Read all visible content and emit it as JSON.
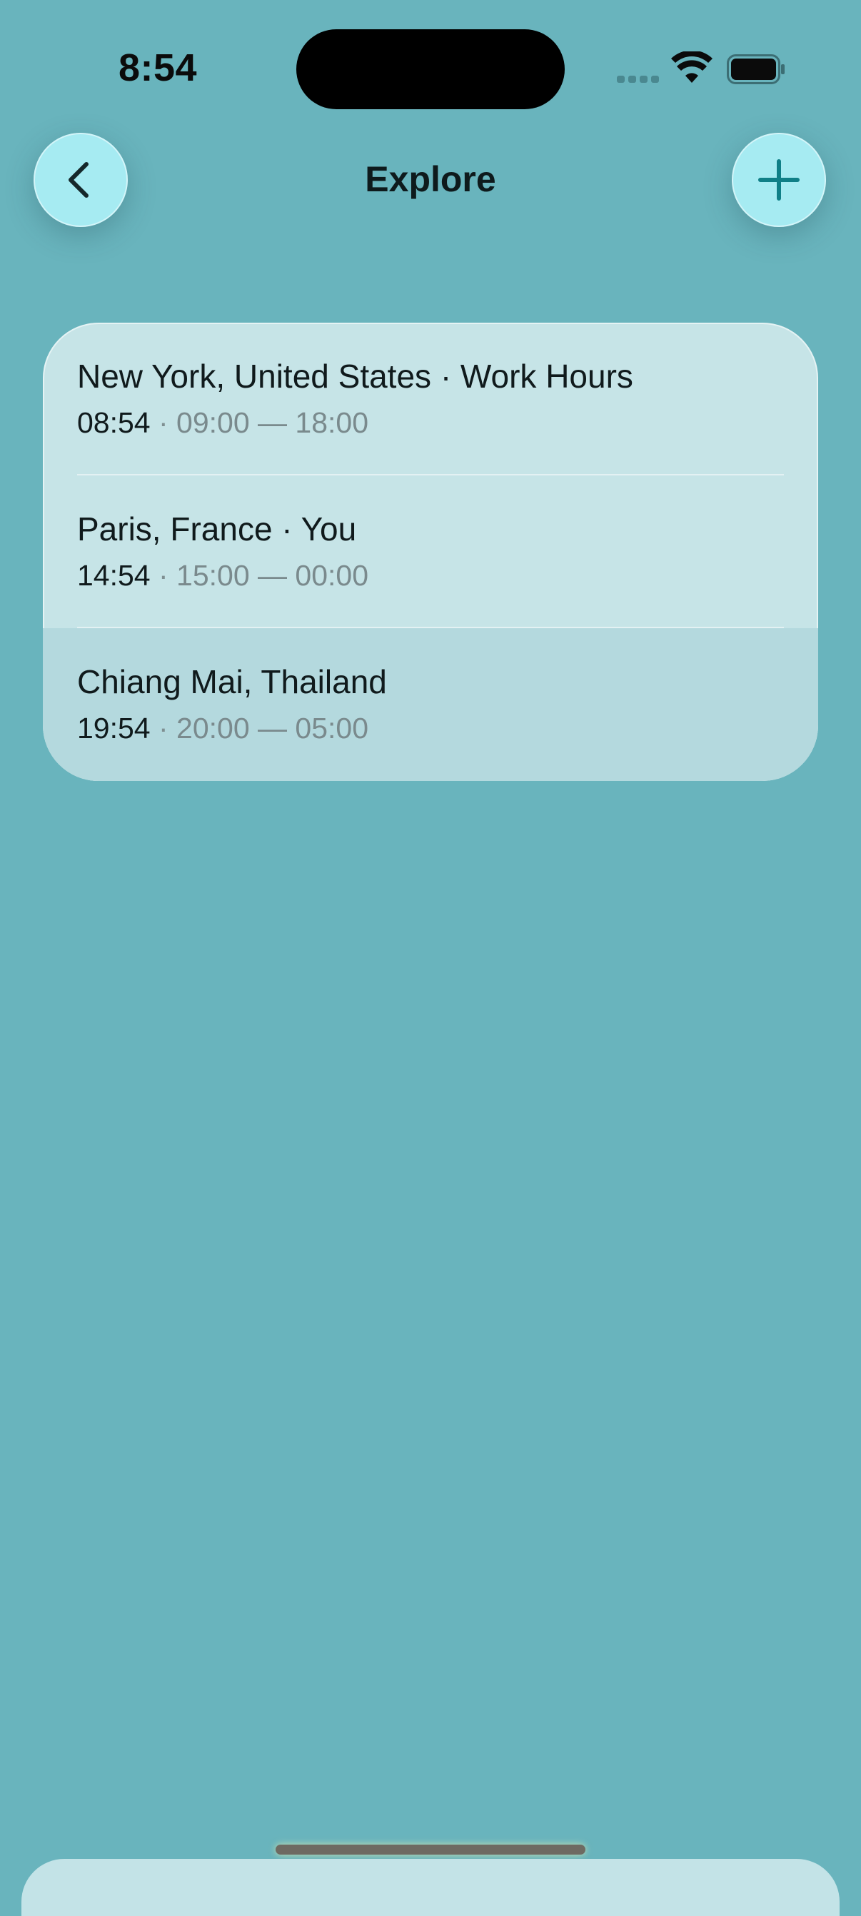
{
  "status_bar": {
    "time": "8:54",
    "icons": [
      "signal-icon",
      "wifi-icon",
      "battery-icon"
    ]
  },
  "nav": {
    "title": "Explore",
    "back_icon": "chevron-left-icon",
    "add_icon": "plus-icon"
  },
  "locations": [
    {
      "title": "New York, United States · Work Hours",
      "current_time": "08:54",
      "separator": " · ",
      "hours": "09:00 — 18:00"
    },
    {
      "title": "Paris, France · You",
      "current_time": "14:54",
      "separator": " · ",
      "hours": "15:00 — 00:00"
    },
    {
      "title": "Chiang Mai, Thailand",
      "current_time": "19:54",
      "separator": " · ",
      "hours": "20:00 — 05:00"
    }
  ],
  "colors": {
    "background": "#69b4bd",
    "button": "#a6ebf2",
    "accent_icon": "#0f7f87",
    "card": "#c6e4e7",
    "selected_row": "#b4d9de"
  }
}
